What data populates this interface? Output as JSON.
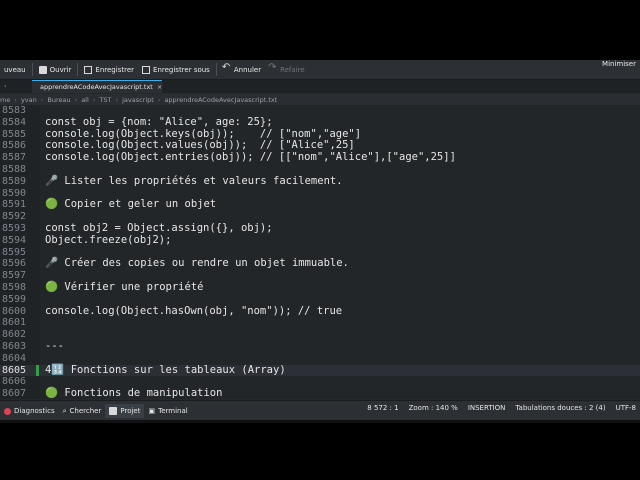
{
  "toolbar": {
    "items": [
      {
        "label": "uveau",
        "disabled": false
      },
      {
        "label": "Ouvrir",
        "disabled": false
      },
      {
        "label": "Enregistrer",
        "disabled": false
      },
      {
        "label": "Enregistrer sous",
        "disabled": false
      },
      {
        "label": "Annuler",
        "disabled": false
      },
      {
        "label": "Refaire",
        "disabled": true
      }
    ],
    "minimize_label": "Minimiser"
  },
  "tabbar": {
    "active_tab": "apprendreACodeAvecJavascript.txt",
    "close_symbol": "×"
  },
  "breadcrumb": [
    "me",
    "yvan",
    "Bureau",
    "all",
    "TST",
    "javascript",
    "apprendreACodeAvecJavascript.txt"
  ],
  "editor": {
    "lines": [
      {
        "n": "8583",
        "text": ""
      },
      {
        "n": "8584",
        "text": "const obj = {nom: \"Alice\", age: 25};"
      },
      {
        "n": "8585",
        "text": "console.log(Object.keys(obj));    // [\"nom\",\"age\"]"
      },
      {
        "n": "8586",
        "text": "console.log(Object.values(obj));  // [\"Alice\",25]"
      },
      {
        "n": "8587",
        "text": "console.log(Object.entries(obj)); // [[\"nom\",\"Alice\"],[\"age\",25]]"
      },
      {
        "n": "8588",
        "text": ""
      },
      {
        "n": "8589",
        "text": "🎤 Lister les propriétés et valeurs facilement."
      },
      {
        "n": "8590",
        "text": ""
      },
      {
        "n": "8591",
        "text": "🟢 Copier et geler un objet"
      },
      {
        "n": "8592",
        "text": ""
      },
      {
        "n": "8593",
        "text": "const obj2 = Object.assign({}, obj);"
      },
      {
        "n": "8594",
        "text": "Object.freeze(obj2);"
      },
      {
        "n": "8595",
        "text": ""
      },
      {
        "n": "8596",
        "text": "🎤 Créer des copies ou rendre un objet immuable."
      },
      {
        "n": "8597",
        "text": ""
      },
      {
        "n": "8598",
        "text": "🟢 Vérifier une propriété"
      },
      {
        "n": "8599",
        "text": ""
      },
      {
        "n": "8600",
        "text": "console.log(Object.hasOwn(obj, \"nom\")); // true"
      },
      {
        "n": "8601",
        "text": ""
      },
      {
        "n": "8602",
        "text": ""
      },
      {
        "n": "8603",
        "text": "---"
      },
      {
        "n": "8604",
        "text": ""
      },
      {
        "n": "8605",
        "text": "4🔢 Fonctions sur les tableaux (Array)"
      },
      {
        "n": "8606",
        "text": ""
      },
      {
        "n": "8607",
        "text": "🟢 Fonctions de manipulation"
      }
    ],
    "current_line": "8605"
  },
  "statusbar": {
    "left": [
      "Diagnostics",
      "Chercher",
      "Projet",
      "Terminal"
    ],
    "active": "Projet",
    "right": [
      "8 572 : 1",
      "Zoom : 140 %",
      "INSERTION",
      "Tabulations douces : 2 (4)",
      "UTF-8"
    ]
  },
  "colors": {
    "accent": "#3daee9",
    "change_marker": "#2ea043"
  }
}
